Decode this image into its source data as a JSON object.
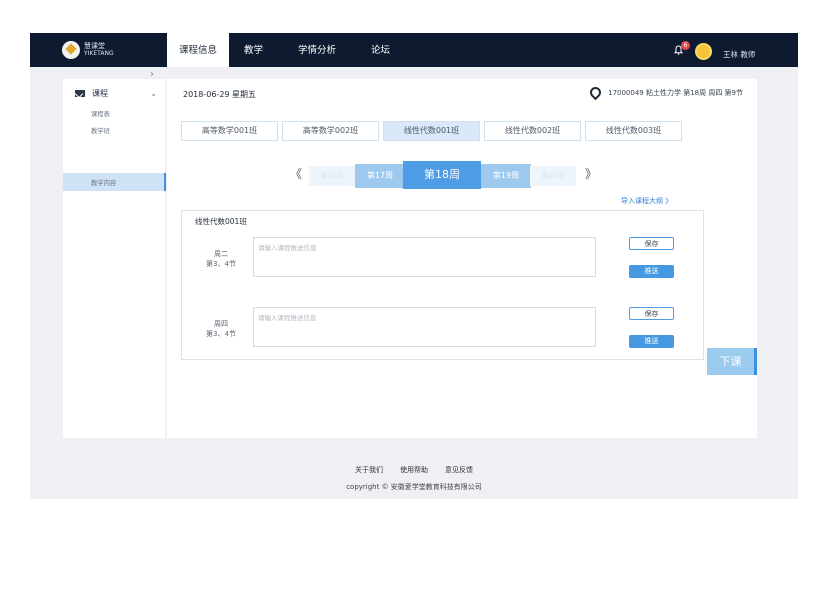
{
  "logo": {
    "line1": "慧课堂",
    "line2": "YIKETANG"
  },
  "nav": {
    "tabs": [
      "课程信息",
      "教学",
      "学情分析",
      "论坛"
    ]
  },
  "header": {
    "notification_count": "6",
    "user_label": "王林  教师"
  },
  "sidebar": {
    "section": "课程",
    "items": [
      "课程表",
      "教学班",
      "教学内容"
    ]
  },
  "main": {
    "date": "2018-06-29  星期五",
    "location": "17000049 粘土性力学 第18周 周四 第9节",
    "classes": [
      "高等数学001班",
      "高等数学002班",
      "线性代数001班",
      "线性代数002班",
      "线性代数003班"
    ],
    "week": {
      "prev": "《",
      "next": "》",
      "items": [
        "第16周",
        "第17周",
        "第18周",
        "第19周",
        "第20周"
      ]
    },
    "import_link": "导入课程大纲 》",
    "panel_title": "线性代数001班",
    "slots": [
      {
        "day": "周二",
        "sections": "第3、4节",
        "placeholder": "请输入课程推送信息",
        "save": "保存",
        "push": "推送"
      },
      {
        "day": "周四",
        "sections": "第3、4节",
        "placeholder": "请输入课程推送信息",
        "save": "保存",
        "push": "推送"
      }
    ]
  },
  "dismiss_button": "下课",
  "footer": {
    "links": [
      "关于我们",
      "使用帮助",
      "意见反馈"
    ],
    "copyright": "copyright © 安徽爱学堂教育科技有限公司"
  }
}
